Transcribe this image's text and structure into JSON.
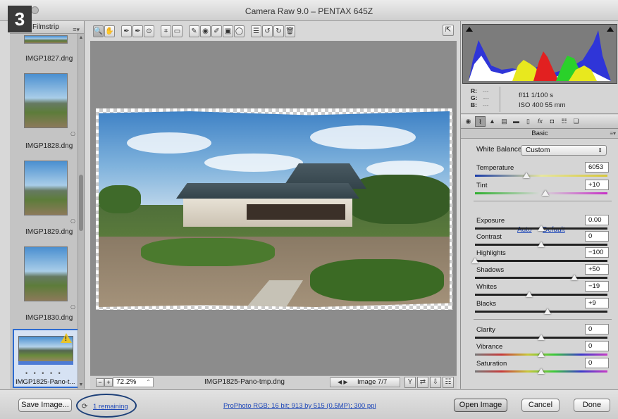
{
  "step_badge": "3",
  "window": {
    "title": "Camera Raw 9.0  –  PENTAX 645Z"
  },
  "filmstrip": {
    "header": "Filmstrip",
    "menu_icon": "≡▾",
    "items": [
      {
        "name": "IMGP1827.dng"
      },
      {
        "name": "IMGP1828.dng"
      },
      {
        "name": "IMGP1829.dng"
      },
      {
        "name": "IMGP1830.dng"
      }
    ],
    "selected": {
      "name": "IMGP1825-Pano-t...",
      "rating_dots": "• • • • •"
    }
  },
  "toolbar": {
    "tools": [
      {
        "name": "zoom-tool-icon",
        "glyph": "🔍"
      },
      {
        "name": "hand-tool-icon",
        "glyph": "✋"
      },
      {
        "name": "white-balance-tool-icon",
        "glyph": "✒"
      },
      {
        "name": "color-sampler-tool-icon",
        "glyph": "✒"
      },
      {
        "name": "targeted-adjustment-tool-icon",
        "glyph": "⊙"
      },
      {
        "name": "crop-tool-icon",
        "glyph": "⌗"
      },
      {
        "name": "straighten-tool-icon",
        "glyph": "▭"
      },
      {
        "name": "spot-removal-tool-icon",
        "glyph": "✎"
      },
      {
        "name": "red-eye-tool-icon",
        "glyph": "◉"
      },
      {
        "name": "adjustment-brush-icon",
        "glyph": "✐"
      },
      {
        "name": "graduated-filter-icon",
        "glyph": "▣"
      },
      {
        "name": "radial-filter-icon",
        "glyph": "◯"
      },
      {
        "name": "preferences-icon",
        "glyph": "☰"
      },
      {
        "name": "rotate-left-icon",
        "glyph": "↺"
      },
      {
        "name": "rotate-right-icon",
        "glyph": "↻"
      },
      {
        "name": "trash-icon",
        "glyph": "🗑"
      }
    ],
    "fullscreen_glyph": "⇱"
  },
  "previewbar": {
    "zoom": "72.2%",
    "filename": "IMGP1825-Pano-tmp.dng",
    "image_counter": "Image 7/7",
    "nav_arrows": "◀  ▶"
  },
  "info": {
    "r_label": "R:",
    "g_label": "G:",
    "b_label": "B:",
    "rgb_value": "---",
    "aperture_shutter": "f/11   1/100 s",
    "iso_focal": "ISO 400   55 mm"
  },
  "panel": {
    "title": "Basic",
    "white_balance_label": "White Balance:",
    "white_balance_value": "Custom",
    "auto_label": "Auto",
    "default_label": "Default",
    "temperature": {
      "label": "Temperature",
      "value": "6053",
      "position": 0.39
    },
    "tint": {
      "label": "Tint",
      "value": "+10",
      "position": 0.53
    },
    "exposure": {
      "label": "Exposure",
      "value": "0.00",
      "position": 0.5
    },
    "contrast": {
      "label": "Contrast",
      "value": "0",
      "position": 0.5
    },
    "highlights": {
      "label": "Highlights",
      "value": "−100",
      "position": 0.0
    },
    "shadows": {
      "label": "Shadows",
      "value": "+50",
      "position": 0.75
    },
    "whites": {
      "label": "Whites",
      "value": "−19",
      "position": 0.41
    },
    "blacks": {
      "label": "Blacks",
      "value": "+9",
      "position": 0.55
    },
    "clarity": {
      "label": "Clarity",
      "value": "0",
      "position": 0.5
    },
    "vibrance": {
      "label": "Vibrance",
      "value": "0",
      "position": 0.5
    },
    "saturation": {
      "label": "Saturation",
      "value": "0",
      "position": 0.5
    }
  },
  "bottom": {
    "save_label": "Save Image...",
    "remaining_label": "1 remaining",
    "workflow_link": "ProPhoto RGB; 16 bit; 913 by 515 (0.5MP); 300 ppi",
    "open_label": "Open Image",
    "cancel_label": "Cancel",
    "done_label": "Done"
  }
}
